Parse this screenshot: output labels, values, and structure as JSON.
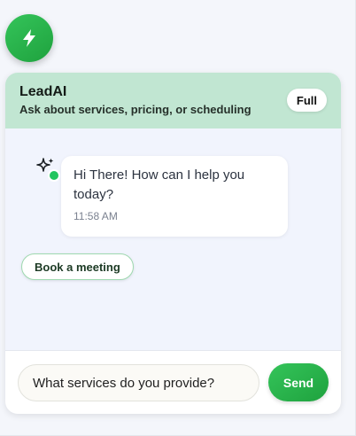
{
  "launcher": {
    "icon": "lightning-bolt-icon"
  },
  "header": {
    "title": "LeadAI",
    "subtitle": "Ask about services, pricing, or scheduling",
    "full_label": "Full"
  },
  "messages": [
    {
      "sender_icon": "sparkle-icon",
      "status": "online",
      "text": "Hi There! How can I help you today?",
      "time": "11:58 AM"
    }
  ],
  "quick_replies": [
    {
      "label": "Book a meeting"
    }
  ],
  "composer": {
    "value": "What services do you provide?",
    "send_label": "Send"
  },
  "colors": {
    "brand_green": "#22b14c",
    "header_bg": "#c1e6d2",
    "online": "#22c55e"
  }
}
